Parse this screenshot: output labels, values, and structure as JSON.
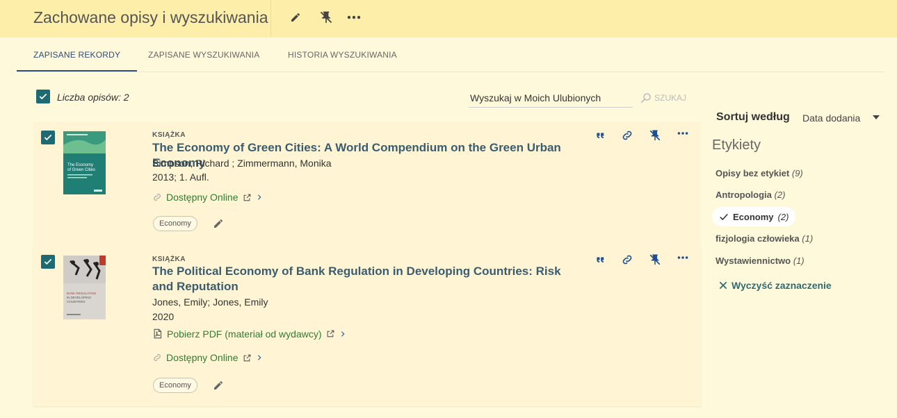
{
  "header": {
    "title": "Zachowane opisy i wyszukiwania"
  },
  "tabs": [
    {
      "label": "ZAPISANE REKORDY"
    },
    {
      "label": "ZAPISANE WYSZUKIWANIA"
    },
    {
      "label": "HISTORIA WYSZUKIWANIA"
    }
  ],
  "toolbar": {
    "count_label": "Liczba opisów: 2",
    "search_value": "Wyszukaj w Moich Ulubionych",
    "search_button": "SZUKAJ"
  },
  "records": [
    {
      "type": "KSIĄŻKA",
      "title": "The Economy of Green Cities: A World Compendium on the Green Urban Economy",
      "authors": "Simpson, Richard ; Zimmermann, Monika",
      "edition": "2013; 1. Aufl.",
      "online": "Dostępny Online",
      "tag": "Economy",
      "cover_text": "The Economy of Green Cities"
    },
    {
      "type": "KSIĄŻKA",
      "title": "The Political Economy of Bank Regulation in Developing Countries: Risk and Reputation",
      "authors": "Jones, Emily; Jones, Emily",
      "edition": "2020",
      "pdf": "Pobierz PDF (materiał od wydawcy)",
      "online": "Dostępny Online",
      "tag": "Economy",
      "cover_text": "BANK REGULATION IN DEVELOPING COUNTRIES"
    }
  ],
  "sidebar": {
    "sort_label": "Sortuj według",
    "sort_value": "Data dodania",
    "facets_title": "Etykiety",
    "facets": [
      {
        "label": "Opisy bez etykiet",
        "count": "(9)"
      },
      {
        "label": "Antropologia",
        "count": "(2)"
      },
      {
        "label": "Economy",
        "count": "(2)"
      },
      {
        "label": "fizjologia człowieka",
        "count": "(1)"
      },
      {
        "label": "Wystawiennictwo",
        "count": "(1)"
      }
    ],
    "clear_label": "Wyczyść zaznaczenie"
  }
}
